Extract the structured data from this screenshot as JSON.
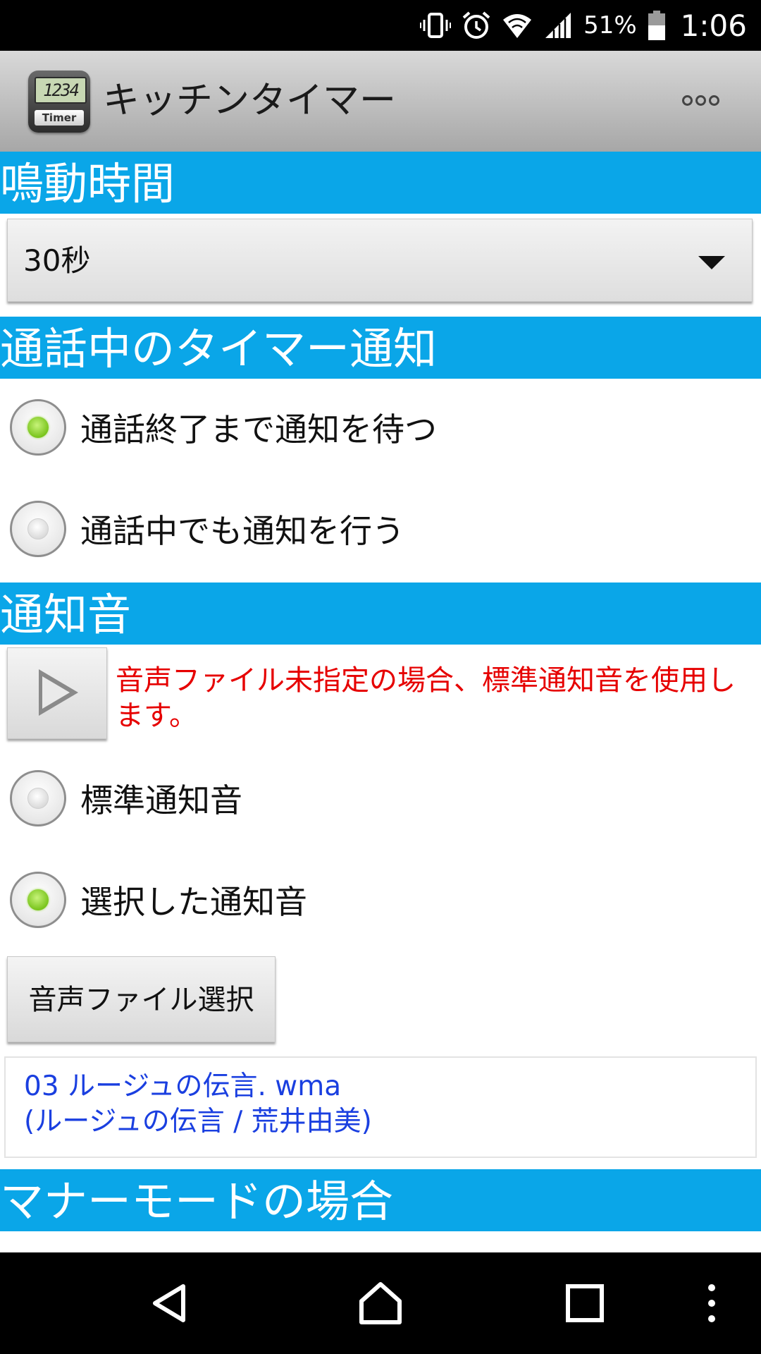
{
  "status_bar": {
    "battery_percent": "51%",
    "time": "1:06",
    "icons": [
      "vibrate-icon",
      "alarm-icon",
      "wifi-icon",
      "signal-icon",
      "battery-icon"
    ]
  },
  "action_bar": {
    "title": "キッチンタイマー",
    "app_icon_display": "1234",
    "app_icon_label": "Timer"
  },
  "sections": {
    "ring_duration": {
      "header": "鳴動時間",
      "selected_value": "30秒"
    },
    "call_notification": {
      "header": "通話中のタイマー通知",
      "options": [
        {
          "label": "通話終了まで通知を待つ",
          "selected": true
        },
        {
          "label": "通話中でも通知を行う",
          "selected": false
        }
      ]
    },
    "notification_sound": {
      "header": "通知音",
      "note": "音声ファイル未指定の場合、標準通知音を使用します。",
      "options": [
        {
          "label": "標準通知音",
          "selected": false
        },
        {
          "label": "選択した通知音",
          "selected": true
        }
      ],
      "select_file_button": "音声ファイル選択",
      "selected_file": {
        "filename": "03 ルージュの伝言. wma",
        "details": "(ルージュの伝言 / 荒井由美)"
      }
    },
    "manner_mode": {
      "header": "マナーモードの場合"
    }
  },
  "colors": {
    "section_header_bg": "#0aa6e8",
    "note_text": "#e60000",
    "file_text": "#1a3fe0",
    "radio_selected": "#79c41c"
  }
}
